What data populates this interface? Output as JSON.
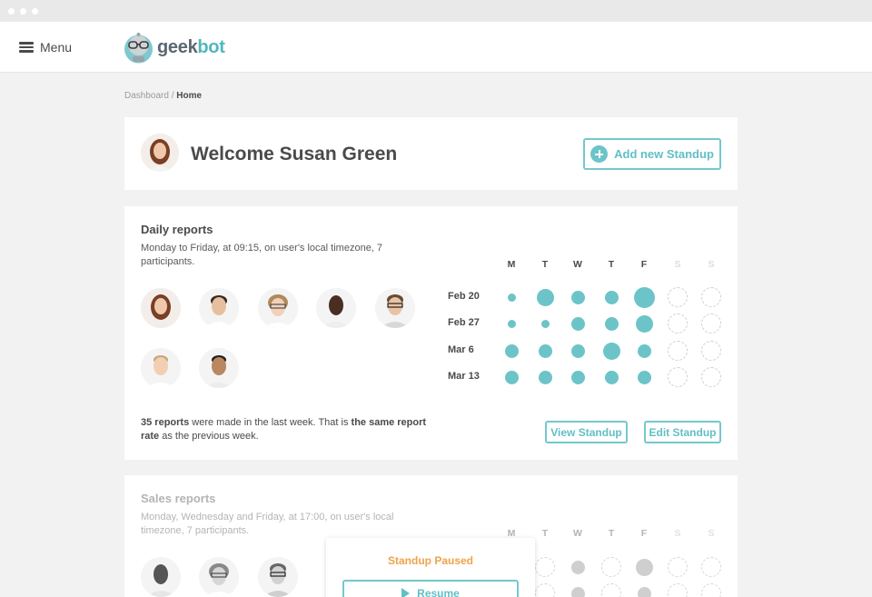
{
  "nav": {
    "menu_label": "Menu",
    "logo_part1": "geek",
    "logo_part2": "bot"
  },
  "breadcrumb": {
    "parent": "Dashboard",
    "separator": " / ",
    "current": "Home"
  },
  "welcome": {
    "title": "Welcome Susan Green",
    "add_button": "Add new Standup"
  },
  "daily": {
    "title": "Daily reports",
    "description": "Monday to Friday, at 09:15, on user's local timezone, 7 participants.",
    "days": [
      "M",
      "T",
      "W",
      "T",
      "F",
      "S",
      "S"
    ],
    "rows": [
      {
        "label": "Feb 20",
        "levels": [
          1,
          3,
          2,
          2,
          4,
          0,
          0
        ]
      },
      {
        "label": "Feb 27",
        "levels": [
          1,
          1,
          2,
          2,
          3,
          0,
          0
        ]
      },
      {
        "label": "Mar 6",
        "levels": [
          2,
          2,
          2,
          3,
          2,
          0,
          0
        ]
      },
      {
        "label": "Mar 13",
        "levels": [
          2,
          2,
          2,
          2,
          2,
          0,
          0
        ]
      }
    ],
    "summary": {
      "count": "35 reports",
      "text1": " were made in the last week. That is ",
      "highlight": "the same report rate",
      "text2": " as the previous week."
    },
    "view_button": "View Standup",
    "edit_button": "Edit Standup"
  },
  "sales": {
    "title": "Sales reports",
    "description": "Monday, Wednesday and Friday, at 17:00, on user's local timezone, 7 participants.",
    "days": [
      "M",
      "T",
      "W",
      "T",
      "F",
      "S",
      "S"
    ],
    "paused_label": "Standup Paused",
    "resume_button": "Resume"
  },
  "colors": {
    "accent": "#6cc4c9",
    "paused": "#f0a24a"
  }
}
